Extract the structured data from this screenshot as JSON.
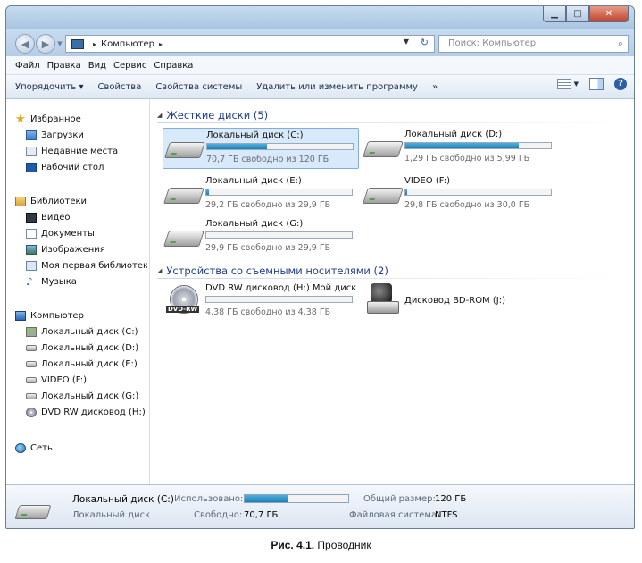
{
  "window": {
    "address": {
      "crumb": "Компьютер",
      "separator": "▸"
    },
    "search_placeholder": "Поиск: Компьютер"
  },
  "menubar": [
    "Файл",
    "Правка",
    "Вид",
    "Сервис",
    "Справка"
  ],
  "toolbar": {
    "organize": "Упорядочить ▾",
    "properties": "Свойства",
    "system_properties": "Свойства системы",
    "uninstall": "Удалить или изменить программу",
    "more": "»"
  },
  "nav": {
    "favorites": {
      "label": "Избранное",
      "items": [
        "Загрузки",
        "Недавние места",
        "Рабочий стол"
      ]
    },
    "libraries": {
      "label": "Библиотеки",
      "items": [
        "Видео",
        "Документы",
        "Изображения",
        "Моя первая библиотека",
        "Музыка"
      ]
    },
    "computer": {
      "label": "Компьютер",
      "items": [
        "Локальный диск (C:)",
        "Локальный диск (D:)",
        "Локальный диск (E:)",
        "VIDEO (F:)",
        "Локальный диск (G:)",
        "DVD RW дисковод (H:)"
      ]
    },
    "network": {
      "label": "Сеть"
    }
  },
  "content": {
    "hdd_group": "Жесткие диски (5)",
    "drives": [
      {
        "name": "Локальный диск (C:)",
        "free": "70,7 ГБ свободно из 120 ГБ",
        "used_fraction": 0.41
      },
      {
        "name": "Локальный диск (D:)",
        "free": "1,29 ГБ свободно из 5,99 ГБ",
        "used_fraction": 0.78
      },
      {
        "name": "Локальный диск (E:)",
        "free": "29,2 ГБ свободно из 29,9 ГБ",
        "used_fraction": 0.02
      },
      {
        "name": "VIDEO (F:)",
        "free": "29,8 ГБ свободно из 30,0 ГБ",
        "used_fraction": 0.01
      },
      {
        "name": "Локальный диск (G:)",
        "free": "29,9 ГБ свободно из 29,9 ГБ",
        "used_fraction": 0.0
      }
    ],
    "removable_group": "Устройства со съемными носителями (2)",
    "removable": [
      {
        "name": "DVD RW дисковод (H:) Мой диск",
        "free": "4,38 ГБ свободно из 4,38 ГБ",
        "used_fraction": 0.0,
        "badge": "DVD-RW"
      },
      {
        "name": "Дисковод BD-ROM (J:)"
      }
    ]
  },
  "details": {
    "name": "Локальный диск (C:)",
    "type": "Локальный диск",
    "used_label": "Использовано:",
    "used_fraction": 0.41,
    "free_label": "Свободно:",
    "free_value": "70,7 ГБ",
    "total_label": "Общий размер:",
    "total_value": "120 ГБ",
    "fs_label": "Файловая система:",
    "fs_value": "NTFS"
  },
  "caption": {
    "bold": "Рис. 4.1.",
    "text": " Проводник"
  }
}
